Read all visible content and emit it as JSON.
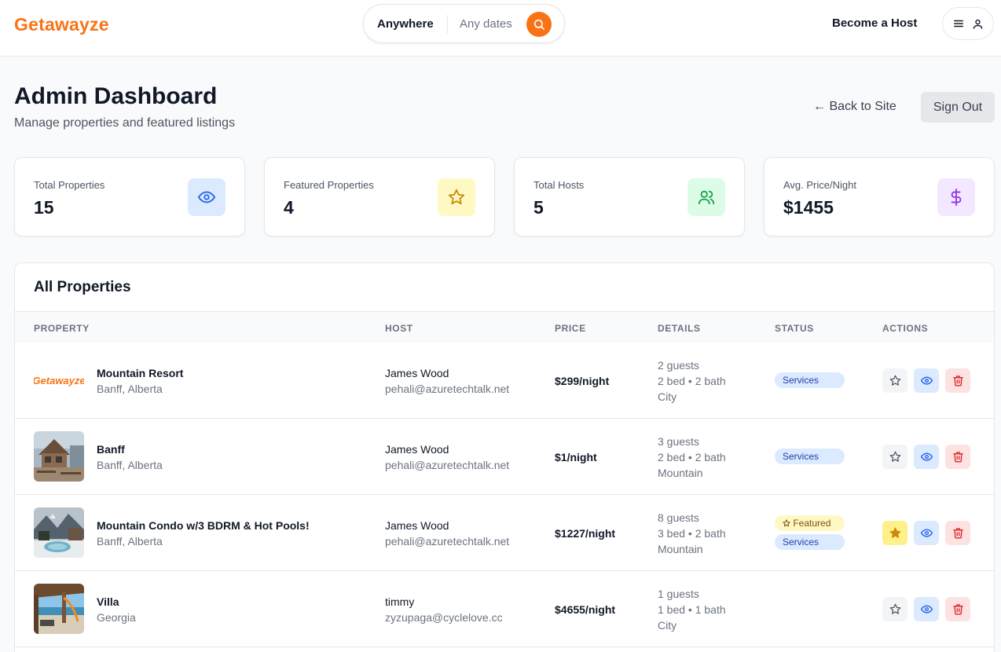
{
  "header": {
    "brand": "Getawayze",
    "search": {
      "where": "Anywhere",
      "dates": "Any dates"
    },
    "become_host": "Become a Host"
  },
  "page": {
    "title": "Admin Dashboard",
    "subtitle": "Manage properties and featured listings",
    "back_link": "← Back to Site",
    "sign_out": "Sign Out"
  },
  "stats": [
    {
      "label": "Total Properties",
      "value": "15",
      "icon": "eye-icon",
      "color": "#2563eb",
      "bg": "#dbeafe"
    },
    {
      "label": "Featured Properties",
      "value": "4",
      "icon": "star-icon",
      "color": "#ca8a04",
      "bg": "#fef9c3"
    },
    {
      "label": "Total Hosts",
      "value": "5",
      "icon": "users-icon",
      "color": "#16a34a",
      "bg": "#dcfce7"
    },
    {
      "label": "Avg. Price/Night",
      "value": "$1455",
      "icon": "dollar-icon",
      "color": "#9333ea",
      "bg": "#f3e8ff"
    }
  ],
  "table": {
    "title": "All Properties",
    "columns": [
      "PROPERTY",
      "HOST",
      "PRICE",
      "DETAILS",
      "STATUS",
      "ACTIONS"
    ],
    "rows": [
      {
        "name": "Mountain Resort",
        "location": "Banff, Alberta",
        "host": "James Wood",
        "email": "pehali@azuretechtalk.net",
        "price": "$299/night",
        "guests": "2 guests",
        "rooms": "2 bed • 2 bath",
        "category": "City",
        "featured": false,
        "featured_label": "",
        "service_label": "Services",
        "thumb": "logo",
        "thumb_text": "Getawayze"
      },
      {
        "name": "Banff",
        "location": "Banff, Alberta",
        "host": "James Wood",
        "email": "pehali@azuretechtalk.net",
        "price": "$1/night",
        "guests": "3 guests",
        "rooms": "2 bed • 2 bath",
        "category": "Mountain",
        "featured": false,
        "featured_label": "",
        "service_label": "Services",
        "thumb": "cabin-photo"
      },
      {
        "name": "Mountain Condo w/3 BDRM & Hot Pools!",
        "location": "Banff, Alberta",
        "host": "James Wood",
        "email": "pehali@azuretechtalk.net",
        "price": "$1227/night",
        "guests": "8 guests",
        "rooms": "3 bed • 2 bath",
        "category": "Mountain",
        "featured": true,
        "featured_label": "Featured",
        "service_label": "Services",
        "thumb": "hot-pool-photo"
      },
      {
        "name": "Villa",
        "location": "Georgia",
        "host": "timmy",
        "email": "zyzupaga@cyclelove.cc",
        "price": "$4655/night",
        "guests": "1 guests",
        "rooms": "1 bed • 1 bath",
        "category": "City",
        "featured": false,
        "featured_label": "",
        "service_label": "",
        "thumb": "beach-villa-photo"
      }
    ]
  }
}
